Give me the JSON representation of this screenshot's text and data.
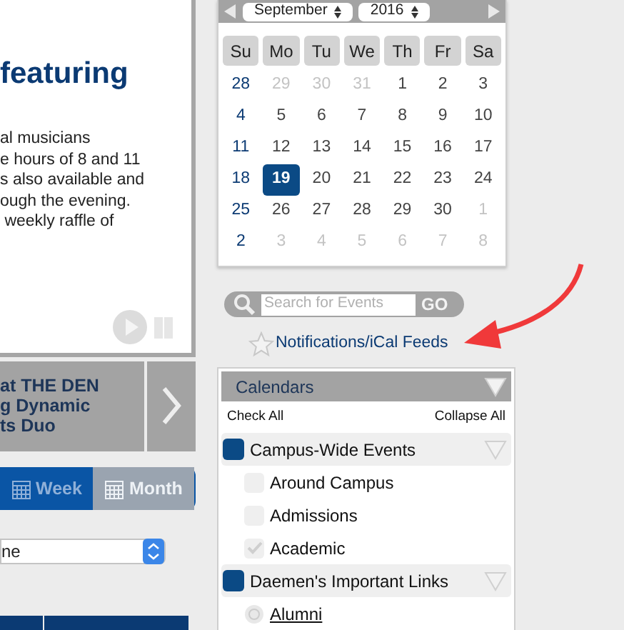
{
  "feature": {
    "heading": "featuring",
    "lines": [
      "al musicians",
      "e hours of 8 and 11",
      "s also available and",
      "ough the evening.",
      " weekly raffle of"
    ]
  },
  "slide_caption": [
    "at THE DEN",
    "g Dynamic",
    "ts Duo"
  ],
  "view_tabs": [
    {
      "label": "Week",
      "selected": false
    },
    {
      "label": "Month",
      "selected": true
    }
  ],
  "select": {
    "value": "ne"
  },
  "calendar": {
    "month": "September",
    "year": "2016",
    "weekdays": [
      "Su",
      "Mo",
      "Tu",
      "We",
      "Th",
      "Fr",
      "Sa"
    ],
    "weeks": [
      [
        {
          "label": "28",
          "muted": false,
          "selected": false
        },
        {
          "label": "29",
          "muted": true,
          "selected": false
        },
        {
          "label": "30",
          "muted": true,
          "selected": false
        },
        {
          "label": "31",
          "muted": true,
          "selected": false
        },
        {
          "label": "1",
          "muted": false,
          "selected": false
        },
        {
          "label": "2",
          "muted": false,
          "selected": false
        },
        {
          "label": "3",
          "muted": false,
          "selected": false
        }
      ],
      [
        {
          "label": "4",
          "muted": false,
          "selected": false
        },
        {
          "label": "5",
          "muted": false,
          "selected": false
        },
        {
          "label": "6",
          "muted": false,
          "selected": false
        },
        {
          "label": "7",
          "muted": false,
          "selected": false
        },
        {
          "label": "8",
          "muted": false,
          "selected": false
        },
        {
          "label": "9",
          "muted": false,
          "selected": false
        },
        {
          "label": "10",
          "muted": false,
          "selected": false
        }
      ],
      [
        {
          "label": "11",
          "muted": false,
          "selected": false
        },
        {
          "label": "12",
          "muted": false,
          "selected": false
        },
        {
          "label": "13",
          "muted": false,
          "selected": false
        },
        {
          "label": "14",
          "muted": false,
          "selected": false
        },
        {
          "label": "15",
          "muted": false,
          "selected": false
        },
        {
          "label": "16",
          "muted": false,
          "selected": false
        },
        {
          "label": "17",
          "muted": false,
          "selected": false
        }
      ],
      [
        {
          "label": "18",
          "muted": false,
          "selected": false
        },
        {
          "label": "19",
          "muted": false,
          "selected": true
        },
        {
          "label": "20",
          "muted": false,
          "selected": false
        },
        {
          "label": "21",
          "muted": false,
          "selected": false
        },
        {
          "label": "22",
          "muted": false,
          "selected": false
        },
        {
          "label": "23",
          "muted": false,
          "selected": false
        },
        {
          "label": "24",
          "muted": false,
          "selected": false
        }
      ],
      [
        {
          "label": "25",
          "muted": false,
          "selected": false
        },
        {
          "label": "26",
          "muted": false,
          "selected": false
        },
        {
          "label": "27",
          "muted": false,
          "selected": false
        },
        {
          "label": "28",
          "muted": false,
          "selected": false
        },
        {
          "label": "29",
          "muted": false,
          "selected": false
        },
        {
          "label": "30",
          "muted": false,
          "selected": false
        },
        {
          "label": "1",
          "muted": true,
          "selected": false
        }
      ],
      [
        {
          "label": "2",
          "muted": false,
          "selected": false
        },
        {
          "label": "3",
          "muted": true,
          "selected": false
        },
        {
          "label": "4",
          "muted": true,
          "selected": false
        },
        {
          "label": "5",
          "muted": true,
          "selected": false
        },
        {
          "label": "6",
          "muted": true,
          "selected": false
        },
        {
          "label": "7",
          "muted": true,
          "selected": false
        },
        {
          "label": "8",
          "muted": true,
          "selected": false
        }
      ]
    ]
  },
  "search": {
    "placeholder": "Search for Events",
    "button": "GO"
  },
  "feeds_link": "Notifications/iCal Feeds",
  "calendars": {
    "title": "Calendars",
    "check_all": "Check All",
    "collapse_all": "Collapse All",
    "groups": [
      {
        "label": "Campus-Wide Events",
        "color": "#0b4a85",
        "items": [
          {
            "kind": "checkbox",
            "label": "Around Campus",
            "checked": false
          },
          {
            "kind": "checkbox",
            "label": "Admissions",
            "checked": false
          },
          {
            "kind": "checkbox",
            "label": "Academic",
            "checked": true
          }
        ]
      },
      {
        "label": "Daemen's Important Links",
        "color": "#0b4a85",
        "items": [
          {
            "kind": "link",
            "label": "Alumni"
          }
        ]
      }
    ]
  }
}
